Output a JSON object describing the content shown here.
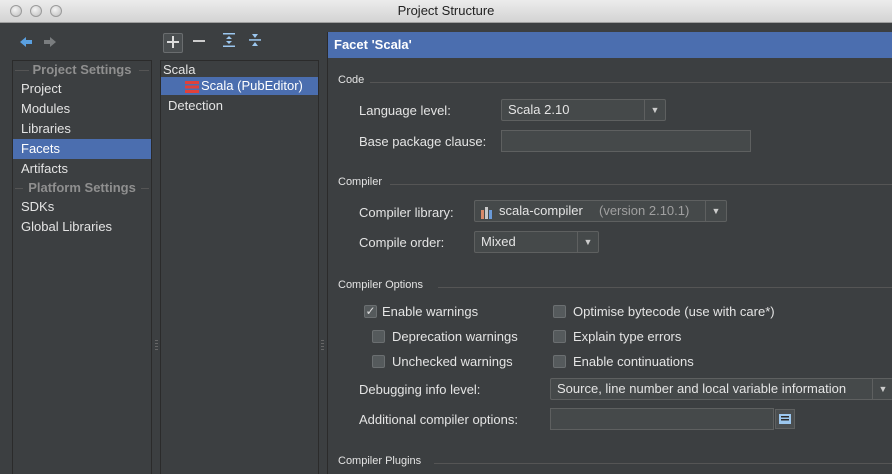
{
  "window": {
    "title": "Project Structure"
  },
  "nav": {
    "project_settings_header": "Project Settings",
    "platform_settings_header": "Platform Settings",
    "items": [
      {
        "label": "Project"
      },
      {
        "label": "Modules"
      },
      {
        "label": "Libraries"
      },
      {
        "label": "Facets"
      },
      {
        "label": "Artifacts"
      },
      {
        "label": "SDKs"
      },
      {
        "label": "Global Libraries"
      }
    ],
    "selected": "Facets"
  },
  "tree": {
    "root": "Scala",
    "child": "Scala (PubEditor)",
    "detection": "Detection"
  },
  "facet": {
    "title": "Facet 'Scala'",
    "code": {
      "group": "Code",
      "language_level_label": "Language level:",
      "language_level_value": "Scala 2.10",
      "base_package_label": "Base package clause:",
      "base_package_value": ""
    },
    "compiler": {
      "group": "Compiler",
      "library_label": "Compiler library:",
      "library_name": "scala-compiler",
      "library_version": "(version 2.10.1)",
      "order_label": "Compile order:",
      "order_value": "Mixed"
    },
    "options": {
      "group": "Compiler Options",
      "enable_warnings": "Enable warnings",
      "deprecation_warnings": "Deprecation warnings",
      "unchecked_warnings": "Unchecked warnings",
      "optimise_bytecode": "Optimise bytecode (use with care*)",
      "explain_type_errors": "Explain type errors",
      "enable_continuations": "Enable continuations",
      "debug_label": "Debugging info level:",
      "debug_value": "Source, line number and local variable information",
      "additional_label": "Additional compiler options:",
      "additional_value": ""
    },
    "plugins": {
      "group": "Compiler Plugins"
    }
  },
  "colors": {
    "accent": "#4b6eaf",
    "background": "#3c3f41"
  }
}
